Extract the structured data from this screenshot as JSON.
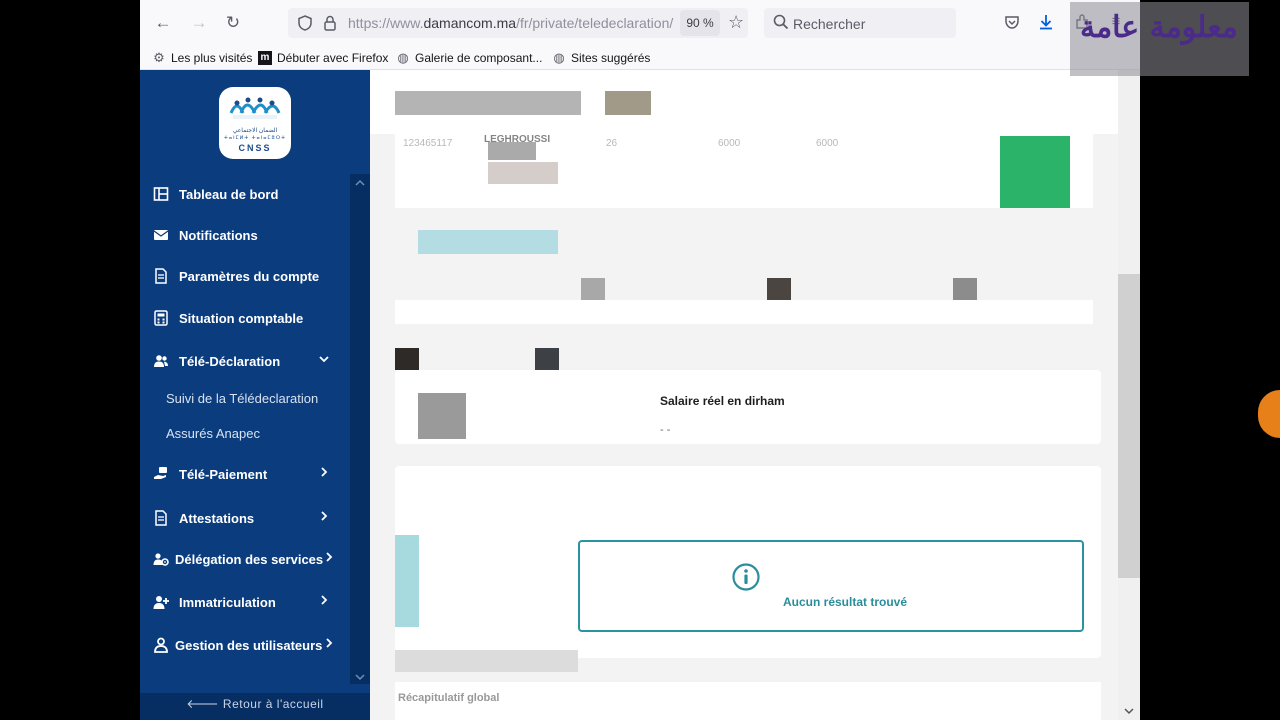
{
  "browser": {
    "url_prefix": "https://www.",
    "url_host": "damancom.ma",
    "url_path": "/fr/private/teledeclaration/",
    "zoom": "90 %",
    "search_placeholder": "Rechercher",
    "bookmarks": [
      {
        "label": "Les plus visités",
        "icon": "gear-icon"
      },
      {
        "label": "Débuter avec Firefox",
        "icon": "mdn-icon"
      },
      {
        "label": "Galerie de composant...",
        "icon": "globe-icon"
      },
      {
        "label": "Sites suggérés",
        "icon": "globe-icon"
      }
    ]
  },
  "watermark": {
    "text": "معلومة عامة"
  },
  "logo": {
    "arabic": "الضمان الاجتماعي",
    "sub": "ⵜⴰⵏⵎⵍⵜ ⵜⴰⵏⴰⵎⵓⵔⵜ",
    "name": "CNSS"
  },
  "sidebar": {
    "items": [
      {
        "label": "Tableau de bord",
        "icon": "dashboard-icon"
      },
      {
        "label": "Notifications",
        "icon": "envelope-icon"
      },
      {
        "label": "Paramètres du compte",
        "icon": "document-icon"
      },
      {
        "label": "Situation comptable",
        "icon": "calculator-icon"
      },
      {
        "label": "Télé-Déclaration",
        "icon": "users-icon",
        "expanded": true
      },
      {
        "label": "Télé-Paiement",
        "icon": "payment-icon"
      },
      {
        "label": "Attestations",
        "icon": "document-icon"
      },
      {
        "label": "Délégation des services",
        "icon": "users-cog-icon"
      },
      {
        "label": "Immatriculation",
        "icon": "user-plus-icon"
      },
      {
        "label": "Gestion des utilisateurs",
        "icon": "user-icon"
      }
    ],
    "subitems": [
      "Suivi de la Télédeclaration",
      "Assurés Anapec"
    ],
    "back_home": "Retour à l'accueil"
  },
  "content": {
    "ghost_row": [
      "123465117",
      "LEGHROUSSI",
      "26",
      "6000",
      "6000"
    ],
    "salaire_label": "Salaire réel en dirham",
    "salaire_value": "- -",
    "no_result": "Aucun résultat trouvé",
    "recap": "Récapitulatif global"
  },
  "colors": {
    "sidebar": "#0b3d7e",
    "accent": "#2a93a0"
  }
}
